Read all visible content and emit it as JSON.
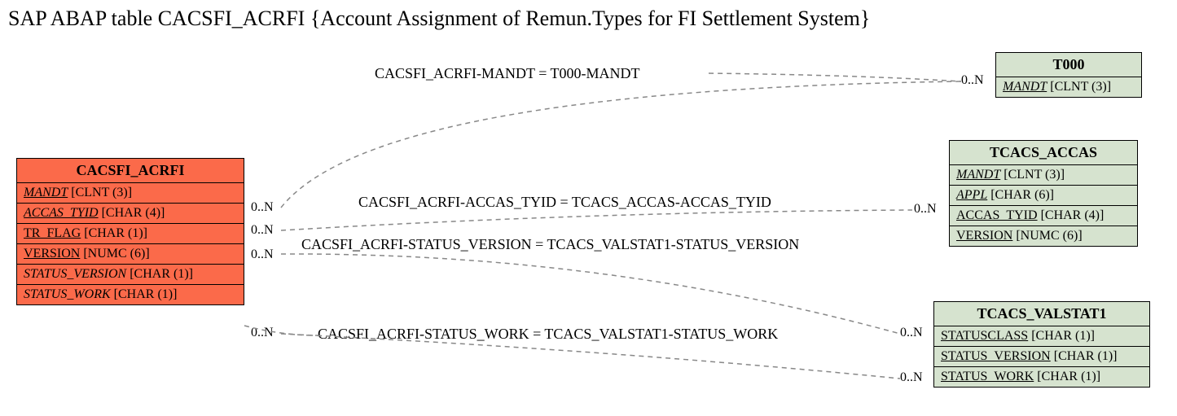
{
  "title": "SAP ABAP table CACSFI_ACRFI {Account Assignment of Remun.Types for FI Settlement System}",
  "entities": {
    "main": {
      "name": "CACSFI_ACRFI",
      "fields": [
        {
          "label": "MANDT",
          "type": "[CLNT (3)]",
          "underline": true,
          "italic": true
        },
        {
          "label": "ACCAS_TYID",
          "type": "[CHAR (4)]",
          "underline": true,
          "italic": true
        },
        {
          "label": "TR_FLAG",
          "type": "[CHAR (1)]",
          "underline": true,
          "italic": false
        },
        {
          "label": "VERSION",
          "type": "[NUMC (6)]",
          "underline": true,
          "italic": false
        },
        {
          "label": "STATUS_VERSION",
          "type": "[CHAR (1)]",
          "underline": false,
          "italic": true
        },
        {
          "label": "STATUS_WORK",
          "type": "[CHAR (1)]",
          "underline": false,
          "italic": true
        }
      ]
    },
    "t000": {
      "name": "T000",
      "fields": [
        {
          "label": "MANDT",
          "type": "[CLNT (3)]",
          "underline": true,
          "italic": true
        }
      ]
    },
    "tcacs_accas": {
      "name": "TCACS_ACCAS",
      "fields": [
        {
          "label": "MANDT",
          "type": "[CLNT (3)]",
          "underline": true,
          "italic": true
        },
        {
          "label": "APPL",
          "type": "[CHAR (6)]",
          "underline": true,
          "italic": true
        },
        {
          "label": "ACCAS_TYID",
          "type": "[CHAR (4)]",
          "underline": true,
          "italic": false
        },
        {
          "label": "VERSION",
          "type": "[NUMC (6)]",
          "underline": true,
          "italic": false
        }
      ]
    },
    "tcacs_valstat1": {
      "name": "TCACS_VALSTAT1",
      "fields": [
        {
          "label": "STATUSCLASS",
          "type": "[CHAR (1)]",
          "underline": true,
          "italic": false
        },
        {
          "label": "STATUS_VERSION",
          "type": "[CHAR (1)]",
          "underline": true,
          "italic": false
        },
        {
          "label": "STATUS_WORK",
          "type": "[CHAR (1)]",
          "underline": true,
          "italic": false
        }
      ]
    }
  },
  "relations": {
    "r1": "CACSFI_ACRFI-MANDT = T000-MANDT",
    "r2": "CACSFI_ACRFI-ACCAS_TYID = TCACS_ACCAS-ACCAS_TYID",
    "r3": "CACSFI_ACRFI-STATUS_VERSION = TCACS_VALSTAT1-STATUS_VERSION",
    "r4": "CACSFI_ACRFI-STATUS_WORK = TCACS_VALSTAT1-STATUS_WORK"
  },
  "cards": {
    "c_main_1": "0..N",
    "c_main_2": "0..N",
    "c_main_3": "0..N",
    "c_main_4": "0..N",
    "c_t000": "0..N",
    "c_accas": "0..N",
    "c_val_1": "0..N",
    "c_val_2": "0..N"
  }
}
